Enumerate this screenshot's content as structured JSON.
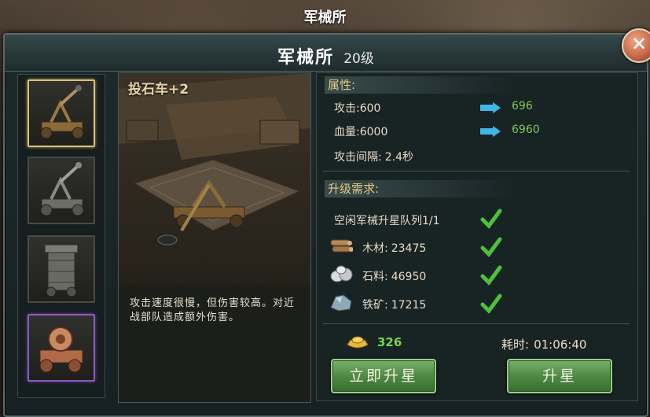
{
  "screen_title": "军械所",
  "window": {
    "title": "军械所",
    "level": "20级",
    "close_icon": "close-icon"
  },
  "units": [
    {
      "name": "catapult-wood",
      "selected": true
    },
    {
      "name": "catapult-grey",
      "selected": false
    },
    {
      "name": "siege-tower-grey",
      "selected": false
    },
    {
      "name": "ram-cart-bronze",
      "selected": false
    }
  ],
  "preview": {
    "name": "投石车+2",
    "description": "攻击速度很慢，但伤害较高。对近战部队造成额外伤害。"
  },
  "attributes": {
    "title": "属性:",
    "attack": {
      "label": "攻击:",
      "current": "600",
      "next": "696"
    },
    "hp": {
      "label": "血量:",
      "current": "6000",
      "next": "6960"
    },
    "interval": {
      "label": "攻击间隔:",
      "value": "2.4秒"
    }
  },
  "requirements": {
    "title": "升级需求:",
    "items": [
      {
        "icon": "queue",
        "text": "空闲军械升星队列1/1",
        "met": true
      },
      {
        "icon": "wood-icon",
        "label": "木材:",
        "value": "23475",
        "met": true
      },
      {
        "icon": "stone-icon",
        "label": "石料:",
        "value": "46950",
        "met": true
      },
      {
        "icon": "iron-ore-icon",
        "label": "铁矿:",
        "value": "17215",
        "met": true
      }
    ]
  },
  "cost": {
    "gold": "326",
    "time_label": "耗时:",
    "time_value": "01:06:40"
  },
  "buttons": {
    "instant": "立即升星",
    "upgrade": "升星"
  },
  "colors": {
    "accent_green": "#7ec95a",
    "gold_text": "#e6c884",
    "arrow_blue": "#3fb7e6"
  }
}
